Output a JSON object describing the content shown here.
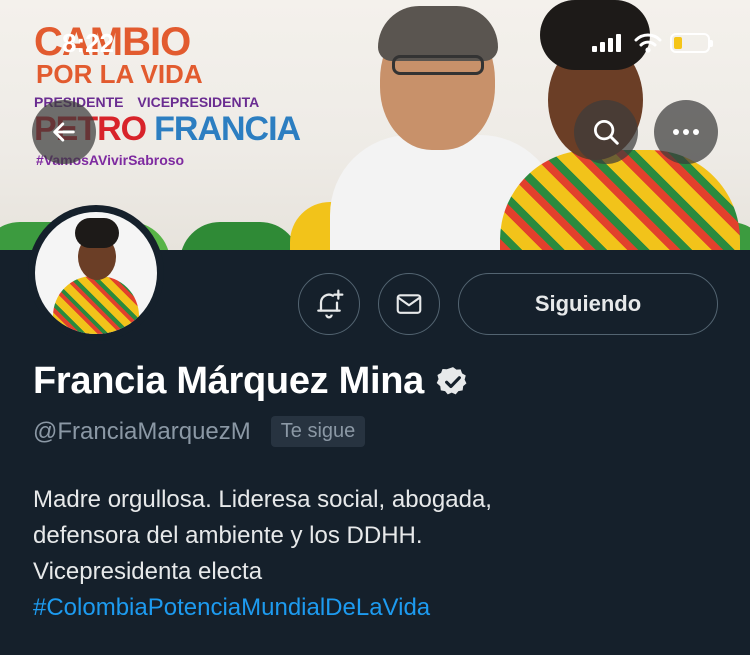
{
  "status_bar": {
    "time": "8:22"
  },
  "banner": {
    "slogan_line1": "CAMBIO",
    "slogan_line2": "POR LA VIDA",
    "role_left": "PRESIDENTE",
    "role_right": "VICEPRESIDENTA",
    "name_left": "PETRO",
    "name_right": "FRANCIA",
    "hashtag": "#VamosAVivirSabroso"
  },
  "actions": {
    "follow_label": "Siguiendo"
  },
  "profile": {
    "display_name": "Francia Márquez Mina",
    "handle": "@FranciaMarquezM",
    "follows_you": "Te sigue",
    "bio_line1": "Madre orgullosa. Lideresa social, abogada,",
    "bio_line2": "defensora del ambiente y los DDHH.",
    "bio_line3": "Vicepresidenta electa",
    "bio_hashtag": "#ColombiaPotenciaMundialDeLaVida"
  },
  "colors": {
    "background": "#15202b",
    "accent": "#1d9bf0",
    "muted": "#8b98a5",
    "border": "#536471"
  },
  "icons": [
    "back-arrow-icon",
    "search-icon",
    "more-icon",
    "bell-plus-icon",
    "mail-icon",
    "verified-badge-icon",
    "signal-icon",
    "wifi-icon",
    "battery-icon"
  ]
}
